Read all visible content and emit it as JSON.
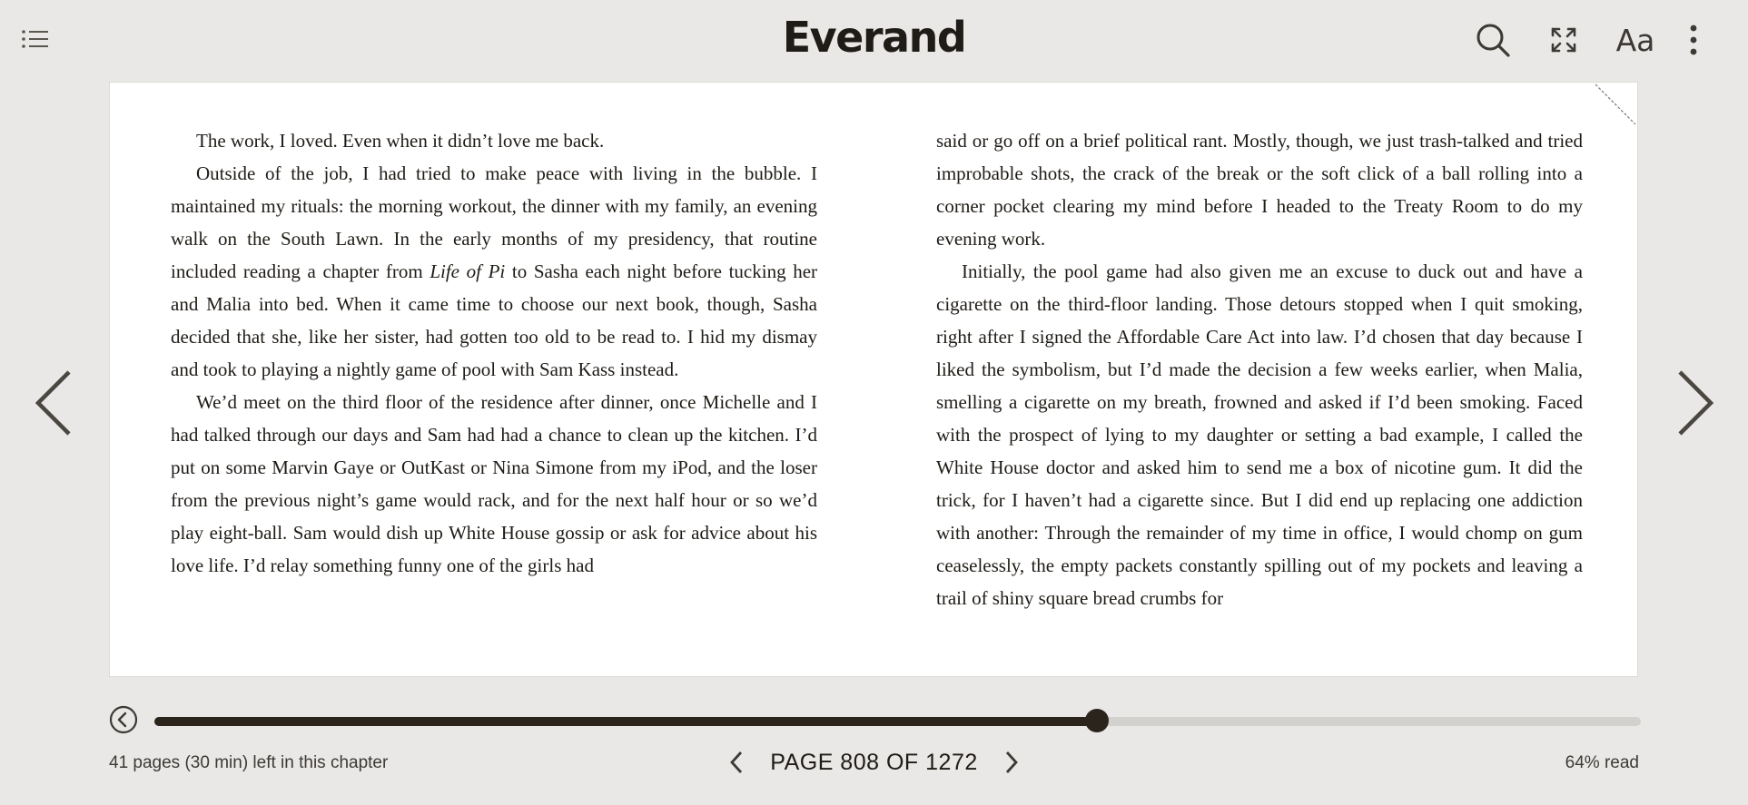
{
  "app": {
    "title": "Everand"
  },
  "toolbar": {
    "toc_icon": "list-icon",
    "search_icon": "search-icon",
    "fullscreen_icon": "fullscreen-icon",
    "font_label": "Aa",
    "more_icon": "more-vertical-icon"
  },
  "page": {
    "left_column": [
      "The work, I loved. Even when it didn’t love me back.",
      "Outside of the job, I had tried to make peace with living in the bubble. I maintained my rituals: the morning workout, the dinner with my family, an evening walk on the South Lawn. In the early months of my presidency, that routine included reading a chapter from",
      "Life of Pi",
      "to Sasha each night before tucking her and Malia into bed. When it came time to choose our next book, though, Sasha decided that she, like her sister, had gotten too old to be read to. I hid my dismay and took to playing a nightly game of pool with Sam Kass in­stead.",
      "We’d meet on the third floor of the residence after dinner, once Michelle and I had talked through our days and Sam had had a chance to clean up the kitchen. I’d put on some Marvin Gaye or OutKast or Nina Simone from my iPod, and the loser from the previous night’s game would rack, and for the next half hour or so we’d play eight-ball. Sam would dish up White House gossip or ask for advice about his love life. I’d relay something funny one of the girls had"
    ],
    "right_column": [
      "said or go off on a brief political rant. Mostly, though, we just trash-talked and tried improbable shots, the crack of the break or the soft click of a ball rolling into a corner pocket clearing my mind before I headed to the Treaty Room to do my evening work.",
      "Initially, the pool game had also given me an excuse to duck out and have a cigarette on the third-floor landing. Those detours stopped when I quit smok­ing, right after I signed the Affordable Care Act into law. I’d chosen that day be­cause I liked the symbolism, but I’d made the decision a few weeks earlier, when Malia, smelling a cigarette on my breath, frowned and asked if I’d been smoking. Faced with the prospect of lying to my daughter or setting a bad example, I called the White House doctor and asked him to send me a box of nicotine gum. It did the trick, for I haven’t had a cigarette since. But I did end up replacing one addiction with another: Through the remainder of my time in office, I would chomp on gum ceaselessly, the empty packets constantly spilling out of my pockets and leaving a trail of shiny square bread crumbs for"
    ]
  },
  "navigation": {
    "prev_icon": "chevron-left-icon",
    "next_icon": "chevron-right-icon"
  },
  "progress": {
    "fraction": 0.634,
    "chapter_remaining": "41 pages (30 min) left in this chapter",
    "page_label": "PAGE 808 OF 1272",
    "read_label": "64% read",
    "back_icon": "back-circle-icon"
  },
  "colors": {
    "background": "#e9e8e6",
    "page": "#ffffff",
    "text": "#1f1b16",
    "progress_fill": "#2a241c",
    "progress_track": "#d3d1cd"
  }
}
